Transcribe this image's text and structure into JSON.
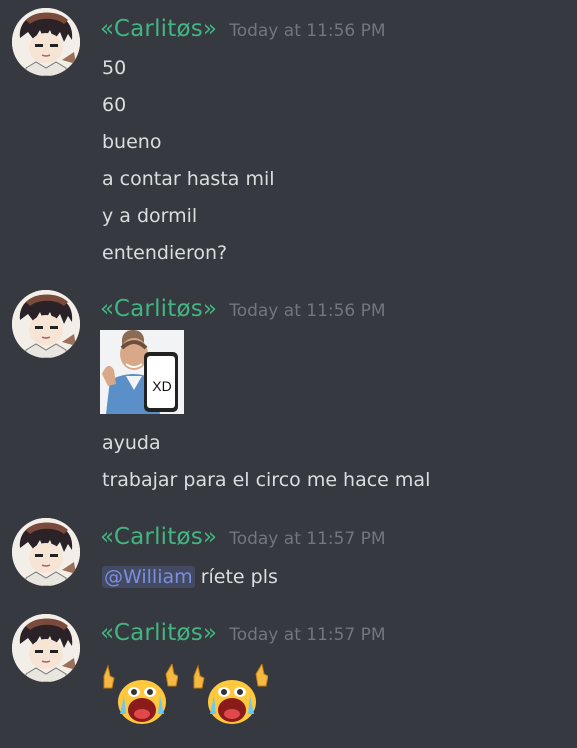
{
  "messages": [
    {
      "author": "«Carlitøs»",
      "timestamp": "Today at 11:56 PM",
      "lines": [
        "50",
        "60",
        "bueno",
        "a contar hasta mil",
        "y a dormil",
        "entendieron?"
      ]
    },
    {
      "author": "«Carlitøs»",
      "timestamp": "Today at 11:56 PM",
      "sticker": {
        "text": "XD",
        "icon": "man-holding-phone-xd-image"
      },
      "lines": [
        "ayuda",
        "trabajar para el circo me hace mal"
      ]
    },
    {
      "author": "«Carlitøs»",
      "timestamp": "Today at 11:57 PM",
      "mention": "@William",
      "text": "ríete pls"
    },
    {
      "author": "«Carlitøs»",
      "timestamp": "Today at 11:57 PM",
      "emoji": [
        "crying-face-thumbs-up-emoji",
        "crying-face-thumbs-up-emoji"
      ]
    }
  ],
  "colors": {
    "background": "#36393f",
    "username": "#43b581",
    "timestamp": "#72767d",
    "text": "#dcddde",
    "mention": "#7b8fde"
  }
}
